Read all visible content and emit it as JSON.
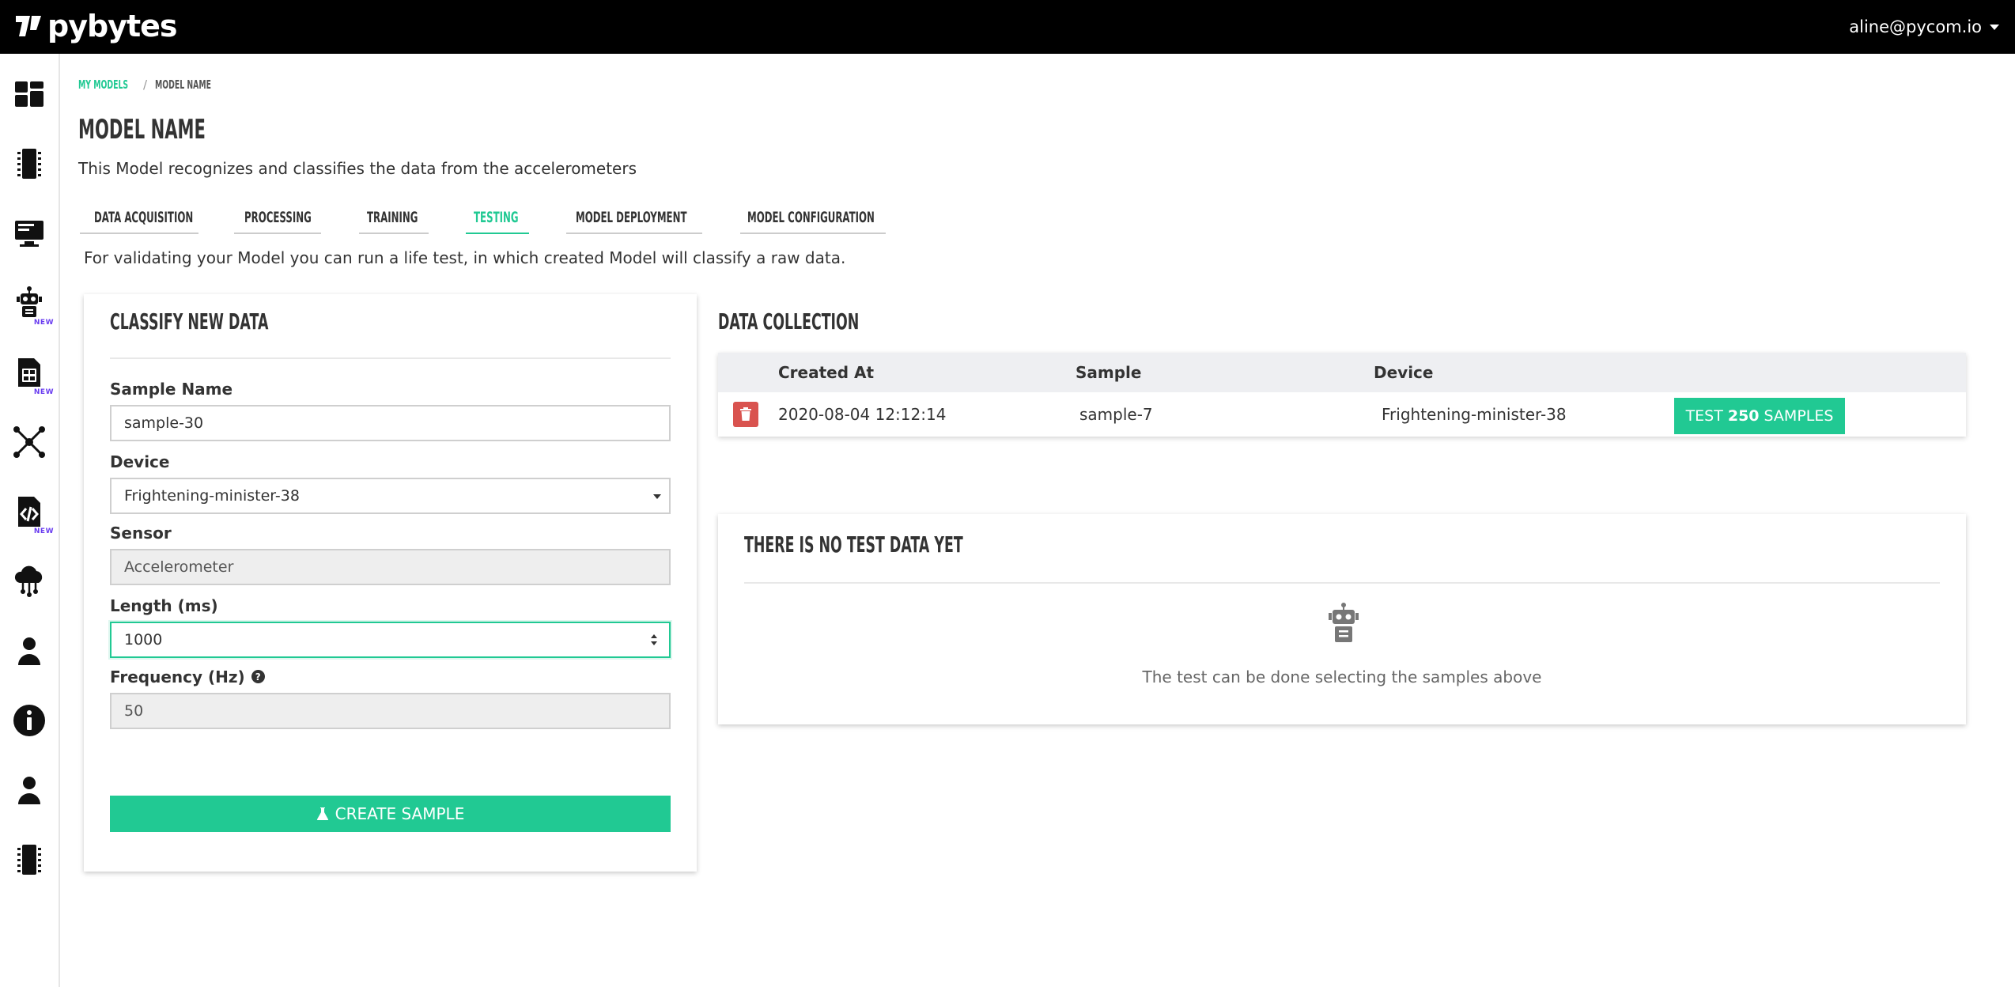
{
  "app": {
    "logo_text": "pybytes",
    "user_email": "aline@pycom.io"
  },
  "sidebar": {
    "items": [
      {
        "icon": "dashboard-icon",
        "badge": ""
      },
      {
        "icon": "devices-icon",
        "badge": ""
      },
      {
        "icon": "projects-icon",
        "badge": ""
      },
      {
        "icon": "robot-icon",
        "badge": "NEW"
      },
      {
        "icon": "sim-card-icon",
        "badge": "NEW"
      },
      {
        "icon": "network-icon",
        "badge": ""
      },
      {
        "icon": "code-file-icon",
        "badge": "NEW"
      },
      {
        "icon": "cloud-integration-icon",
        "badge": ""
      },
      {
        "icon": "user-icon",
        "badge": ""
      },
      {
        "icon": "info-icon",
        "badge": ""
      },
      {
        "icon": "account-icon",
        "badge": ""
      },
      {
        "icon": "device-chip-icon",
        "badge": ""
      }
    ]
  },
  "breadcrumb": {
    "parent": "MY MODELS",
    "separator": "/",
    "current": "MODEL NAME"
  },
  "page": {
    "title": "MODEL NAME",
    "description": "This Model recognizes and classifies the data from the accelerometers"
  },
  "tabs": [
    {
      "label": "DATA ACQUISITION",
      "active": false
    },
    {
      "label": "PROCESSING",
      "active": false
    },
    {
      "label": "TRAINING",
      "active": false
    },
    {
      "label": "TESTING",
      "active": true
    },
    {
      "label": "MODEL DEPLOYMENT",
      "active": false
    },
    {
      "label": "MODEL CONFIGURATION",
      "active": false
    }
  ],
  "testing": {
    "description": "For validating your Model you can run a life test, in which created Model will classify a raw data."
  },
  "classify": {
    "title": "CLASSIFY NEW DATA",
    "sample_name_label": "Sample Name",
    "sample_name_value": "sample-30",
    "device_label": "Device",
    "device_value": "Frightening-minister-38",
    "sensor_label": "Sensor",
    "sensor_value": "Accelerometer",
    "length_label": "Length (ms)",
    "length_value": "1000",
    "frequency_label": "Frequency (Hz)",
    "frequency_value": "50",
    "help_glyph": "?",
    "create_button": "CREATE SAMPLE"
  },
  "data_collection": {
    "title": "DATA COLLECTION",
    "columns": [
      "Created At",
      "Sample",
      "Device"
    ],
    "rows": [
      {
        "created_at": "2020-08-04 12:12:14",
        "sample": "sample-7",
        "device": "Frightening-minister-38",
        "test_prefix": "TEST",
        "test_count": "250",
        "test_suffix": "SAMPLES"
      }
    ]
  },
  "test_results": {
    "title": "THERE IS NO TEST DATA YET",
    "empty_message": "The test can be done selecting the samples above"
  },
  "colors": {
    "accent": "#21c993",
    "danger": "#d9534f",
    "topbar": "#000000",
    "new_badge": "#6a3df0"
  }
}
